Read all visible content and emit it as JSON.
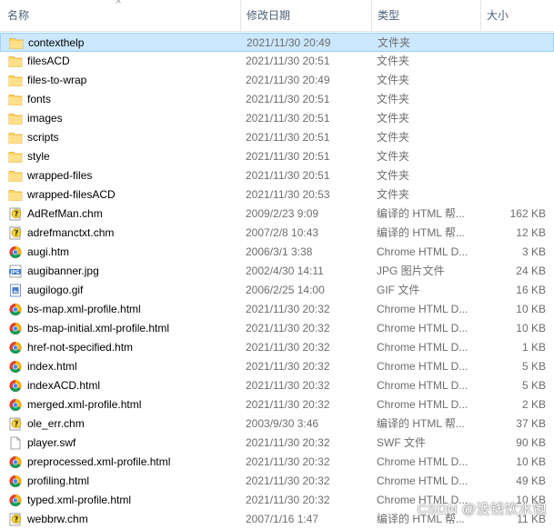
{
  "header": {
    "name_label": "名称",
    "date_label": "修改日期",
    "type_label": "类型",
    "size_label": "大小",
    "sort_indicator": "^"
  },
  "files": [
    {
      "name": "contexthelp",
      "date": "2021/11/30 20:49",
      "type": "文件夹",
      "size": "",
      "icon": "folder-icon",
      "selected": true
    },
    {
      "name": "filesACD",
      "date": "2021/11/30 20:51",
      "type": "文件夹",
      "size": "",
      "icon": "folder-icon"
    },
    {
      "name": "files-to-wrap",
      "date": "2021/11/30 20:49",
      "type": "文件夹",
      "size": "",
      "icon": "folder-icon"
    },
    {
      "name": "fonts",
      "date": "2021/11/30 20:51",
      "type": "文件夹",
      "size": "",
      "icon": "folder-icon"
    },
    {
      "name": "images",
      "date": "2021/11/30 20:51",
      "type": "文件夹",
      "size": "",
      "icon": "folder-icon"
    },
    {
      "name": "scripts",
      "date": "2021/11/30 20:51",
      "type": "文件夹",
      "size": "",
      "icon": "folder-icon"
    },
    {
      "name": "style",
      "date": "2021/11/30 20:51",
      "type": "文件夹",
      "size": "",
      "icon": "folder-icon"
    },
    {
      "name": "wrapped-files",
      "date": "2021/11/30 20:51",
      "type": "文件夹",
      "size": "",
      "icon": "folder-icon"
    },
    {
      "name": "wrapped-filesACD",
      "date": "2021/11/30 20:53",
      "type": "文件夹",
      "size": "",
      "icon": "folder-icon"
    },
    {
      "name": "AdRefMan.chm",
      "date": "2009/2/23 9:09",
      "type": "编译的 HTML 帮...",
      "size": "162 KB",
      "icon": "chm-help-icon"
    },
    {
      "name": "adrefmanctxt.chm",
      "date": "2007/2/8 10:43",
      "type": "编译的 HTML 帮...",
      "size": "12 KB",
      "icon": "chm-help-icon"
    },
    {
      "name": "augi.htm",
      "date": "2006/3/1 3:38",
      "type": "Chrome HTML D...",
      "size": "3 KB",
      "icon": "chrome-icon"
    },
    {
      "name": "augibanner.jpg",
      "date": "2002/4/30 14:11",
      "type": "JPG 图片文件",
      "size": "24 KB",
      "icon": "jpg-icon"
    },
    {
      "name": "augilogo.gif",
      "date": "2006/2/25 14:00",
      "type": "GIF 文件",
      "size": "16 KB",
      "icon": "gif-icon"
    },
    {
      "name": "bs-map.xml-profile.html",
      "date": "2021/11/30 20:32",
      "type": "Chrome HTML D...",
      "size": "10 KB",
      "icon": "chrome-icon"
    },
    {
      "name": "bs-map-initial.xml-profile.html",
      "date": "2021/11/30 20:32",
      "type": "Chrome HTML D...",
      "size": "10 KB",
      "icon": "chrome-icon"
    },
    {
      "name": "href-not-specified.htm",
      "date": "2021/11/30 20:32",
      "type": "Chrome HTML D...",
      "size": "1 KB",
      "icon": "chrome-icon"
    },
    {
      "name": "index.html",
      "date": "2021/11/30 20:32",
      "type": "Chrome HTML D...",
      "size": "5 KB",
      "icon": "chrome-icon"
    },
    {
      "name": "indexACD.html",
      "date": "2021/11/30 20:32",
      "type": "Chrome HTML D...",
      "size": "5 KB",
      "icon": "chrome-icon"
    },
    {
      "name": "merged.xml-profile.html",
      "date": "2021/11/30 20:32",
      "type": "Chrome HTML D...",
      "size": "2 KB",
      "icon": "chrome-icon"
    },
    {
      "name": "ole_err.chm",
      "date": "2003/9/30 3:46",
      "type": "编译的 HTML 帮...",
      "size": "37 KB",
      "icon": "chm-help-icon"
    },
    {
      "name": "player.swf",
      "date": "2021/11/30 20:32",
      "type": "SWF 文件",
      "size": "90 KB",
      "icon": "generic-file-icon"
    },
    {
      "name": "preprocessed.xml-profile.html",
      "date": "2021/11/30 20:32",
      "type": "Chrome HTML D...",
      "size": "10 KB",
      "icon": "chrome-icon"
    },
    {
      "name": "profiling.html",
      "date": "2021/11/30 20:32",
      "type": "Chrome HTML D...",
      "size": "49 KB",
      "icon": "chrome-icon"
    },
    {
      "name": "typed.xml-profile.html",
      "date": "2021/11/30 20:32",
      "type": "Chrome HTML D...",
      "size": "10 KB",
      "icon": "chrome-icon"
    },
    {
      "name": "webbrw.chm",
      "date": "2007/1/16 1:47",
      "type": "编译的 HTML 帮...",
      "size": "11 KB",
      "icon": "chm-help-icon"
    }
  ],
  "watermark": "CSDN @没钱饮水饱",
  "colors": {
    "folder": "#ffd75e",
    "selection_bg": "#cce8ff",
    "selection_border": "#99d1ff",
    "header_text": "#4c607a"
  }
}
